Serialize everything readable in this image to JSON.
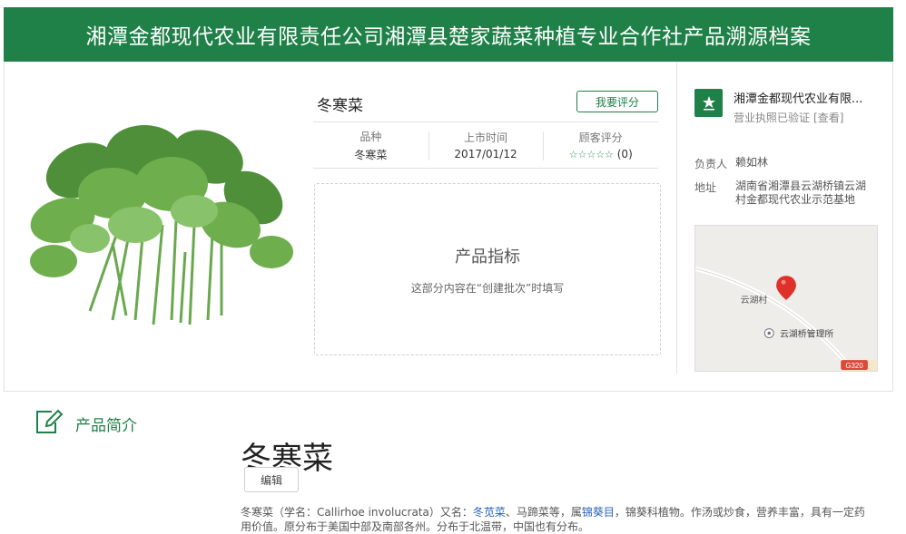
{
  "header": {
    "title": "湘潭金都现代农业有限责任公司湘潭县楚家蔬菜种植专业合作社产品溯源档案"
  },
  "product": {
    "name": "冬寒菜",
    "rate_button": "我要评分",
    "variety": {
      "label": "品种",
      "value": "冬寒菜"
    },
    "launch": {
      "label": "上市时间",
      "value": "2017/01/12"
    },
    "rating": {
      "label": "顾客评分",
      "stars": "☆☆☆☆☆",
      "count": "(0)"
    },
    "index": {
      "title": "产品指标",
      "desc": "这部分内容在“创建批次”时填写"
    }
  },
  "company": {
    "name": "湘潭金都现代农业有限...",
    "verified": "营业执照已验证",
    "view_link": "[查看]",
    "manager_label": "负责人",
    "manager": "赖如林",
    "address_label": "地址",
    "address": "湖南省湘潭县云湖桥镇云湖村金都现代农业示范基地"
  },
  "map": {
    "village": "云湖村",
    "office": "云湖桥管理所",
    "road": "G320"
  },
  "intro": {
    "section_title": "产品简介",
    "title": "冬寒菜",
    "edit_button": "编辑",
    "desc_1": "冬寒菜（学名：Callirhoe involucrata）又名：",
    "link_1": "冬苋菜",
    "desc_2": "、马蹄菜等，属",
    "link_2": "锦葵目",
    "desc_3": "，锦葵科植物。作汤或炒食，营养丰富，具有一定药用价值。原分布于美国中部及南部各州。分布于北温带，中国也有分布。"
  },
  "colors": {
    "brand": "#1f8048",
    "link": "#2a63b8",
    "map_pin": "#e0302a"
  },
  "icons": {
    "company_badge": "star-badge-icon",
    "intro": "edit-note-icon",
    "pin": "map-pin-icon",
    "office": "poi-dot-icon"
  }
}
